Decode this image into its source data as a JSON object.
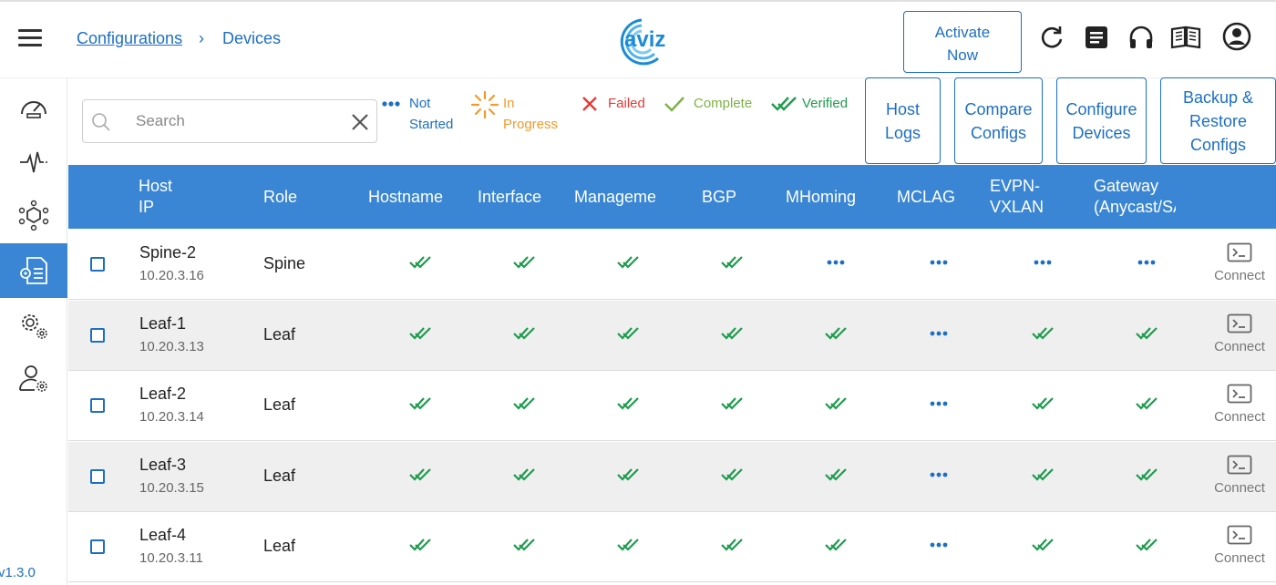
{
  "header": {
    "breadcrumb_root": "Configurations",
    "breadcrumb_sep": "›",
    "breadcrumb_current": "Devices",
    "logo_text": "aviz",
    "activate_line1": "Activate",
    "activate_line2": "Now"
  },
  "sidebar": {
    "version": "v1.3.0"
  },
  "toolbar": {
    "search_placeholder": "Search",
    "legend": {
      "not_started_1": "Not",
      "not_started_2": "Started",
      "in_progress_1": "In",
      "in_progress_2": "Progress",
      "failed": "Failed",
      "complete": "Complete",
      "verified": "Verified"
    },
    "buttons": {
      "host_logs_1": "Host",
      "host_logs_2": "Logs",
      "compare_1": "Compare",
      "compare_2": "Configs",
      "configure_1": "Configure",
      "configure_2": "Devices",
      "backup_1": "Backup &",
      "backup_2": "Restore",
      "backup_3": "Configs"
    }
  },
  "colors": {
    "accent": "#3a86d4",
    "link": "#1d6fc4",
    "verified": "#1e9b4e",
    "complete": "#7cb342",
    "failed": "#e53935",
    "in_progress": "#f39a2b"
  },
  "table": {
    "headers": {
      "host_1": "Host",
      "host_2": "IP",
      "role": "Role",
      "hostname": "Hostname",
      "interface": "Interface",
      "management": "Management",
      "bgp": "BGP",
      "mhoming": "MHoming",
      "mclag": "MCLAG",
      "evpn_1": "EVPN-",
      "evpn_2": "VXLAN",
      "gateway_1": "Gateway",
      "gateway_2": "(Anycast/SAG)"
    },
    "connect_label": "Connect",
    "rows": [
      {
        "name": "Spine-2",
        "ip": "10.20.3.16",
        "role": "Spine",
        "status": [
          "verified",
          "verified",
          "verified",
          "verified",
          "not_started",
          "not_started",
          "not_started",
          "not_started"
        ]
      },
      {
        "name": "Leaf-1",
        "ip": "10.20.3.13",
        "role": "Leaf",
        "status": [
          "verified",
          "verified",
          "verified",
          "verified",
          "verified",
          "not_started",
          "verified",
          "verified"
        ]
      },
      {
        "name": "Leaf-2",
        "ip": "10.20.3.14",
        "role": "Leaf",
        "status": [
          "verified",
          "verified",
          "verified",
          "verified",
          "verified",
          "not_started",
          "verified",
          "verified"
        ]
      },
      {
        "name": "Leaf-3",
        "ip": "10.20.3.15",
        "role": "Leaf",
        "status": [
          "verified",
          "verified",
          "verified",
          "verified",
          "verified",
          "not_started",
          "verified",
          "verified"
        ]
      },
      {
        "name": "Leaf-4",
        "ip": "10.20.3.11",
        "role": "Leaf",
        "status": [
          "verified",
          "verified",
          "verified",
          "verified",
          "verified",
          "not_started",
          "verified",
          "verified"
        ]
      }
    ]
  }
}
